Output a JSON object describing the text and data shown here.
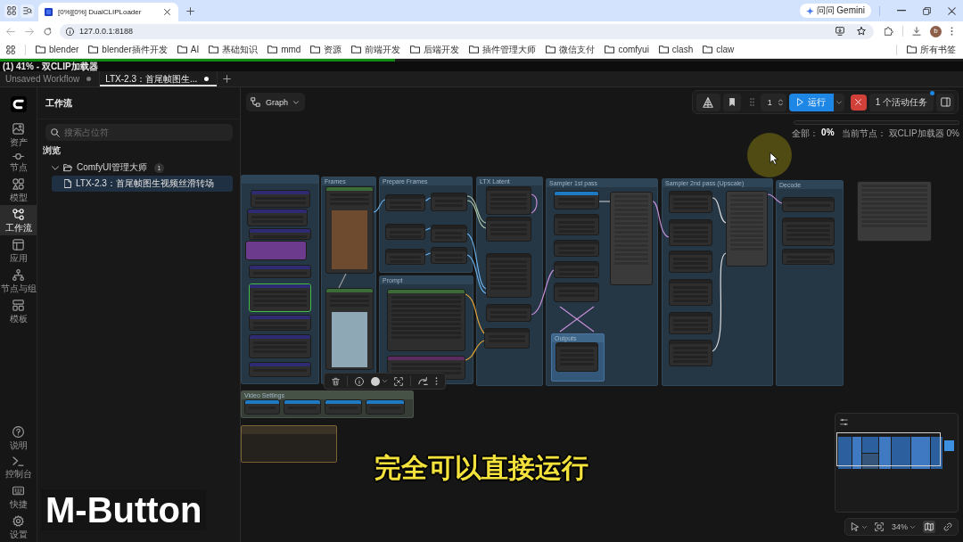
{
  "browser": {
    "tabs": [
      {
        "title": "[0%][0%] DualCLIPLoader",
        "selected": true
      }
    ],
    "gemini_button": "问问 Gemini",
    "address": "127.0.0.1:8188",
    "profile_initial": "b",
    "bookmarks": [
      "blender",
      "blender插件开发",
      "AI",
      "基础知识",
      "mmd",
      "资源",
      "前端开发",
      "后端开发",
      "插件管理大师",
      "微信支付",
      "comfyui",
      "clash",
      "claw"
    ],
    "all_bookmarks": "所有书签"
  },
  "app": {
    "progress": {
      "level": 0.41,
      "text": "(1) 41% - 双CLIP加载器"
    },
    "workflow_tabs": [
      {
        "label": "Unsaved Workflow",
        "selected": false,
        "modified": true
      },
      {
        "label": "LTX-2.3：首尾帧图生...",
        "selected": true,
        "modified": true
      }
    ]
  },
  "rail": {
    "items": [
      {
        "label": "资产",
        "selected": false
      },
      {
        "label": "节点",
        "selected": false
      },
      {
        "label": "模型",
        "selected": false
      },
      {
        "label": "工作流",
        "selected": true
      },
      {
        "label": "应用",
        "selected": false
      },
      {
        "label": "节点与组",
        "selected": false
      },
      {
        "label": "模板",
        "selected": false
      }
    ],
    "bottom_items": [
      {
        "label": "说明"
      },
      {
        "label": "控制台"
      },
      {
        "label": "快捷"
      },
      {
        "label": "设置"
      }
    ]
  },
  "sidebar": {
    "title": "工作流",
    "search": {
      "placeholder": "搜索占位符"
    },
    "section": "浏览",
    "tree": [
      {
        "label": "ComfyUI管理大师",
        "count": "1",
        "expanded": true,
        "children": [
          {
            "label": "LTX-2.3：首尾帧图生视频丝滑转场",
            "selected": true
          }
        ]
      }
    ]
  },
  "canvas": {
    "mode_button": "Graph",
    "queue": {
      "batch_count": "1",
      "run_button": "运行",
      "active_jobs": "1 个活动任务"
    },
    "progress": {
      "level": 0,
      "total_label": "全部：",
      "total_value": "0%",
      "current_label": "当前节点：",
      "current_value": "双CLIP加载器 0%"
    },
    "groups": [
      {
        "title": "Frames"
      },
      {
        "title": "Prepare Frames"
      },
      {
        "title": "Prompt"
      },
      {
        "title": "LTX Latent"
      },
      {
        "title": "Sampler 1st pass"
      },
      {
        "title": "Outputs"
      },
      {
        "title": "Sampler 2nd pass (Upscale)"
      },
      {
        "title": "Decode"
      },
      {
        "title": "Video Settings"
      }
    ],
    "zoom": "34%"
  },
  "overlays": {
    "subtitle": "完全可以直接运行",
    "key_display": "M-Button"
  }
}
